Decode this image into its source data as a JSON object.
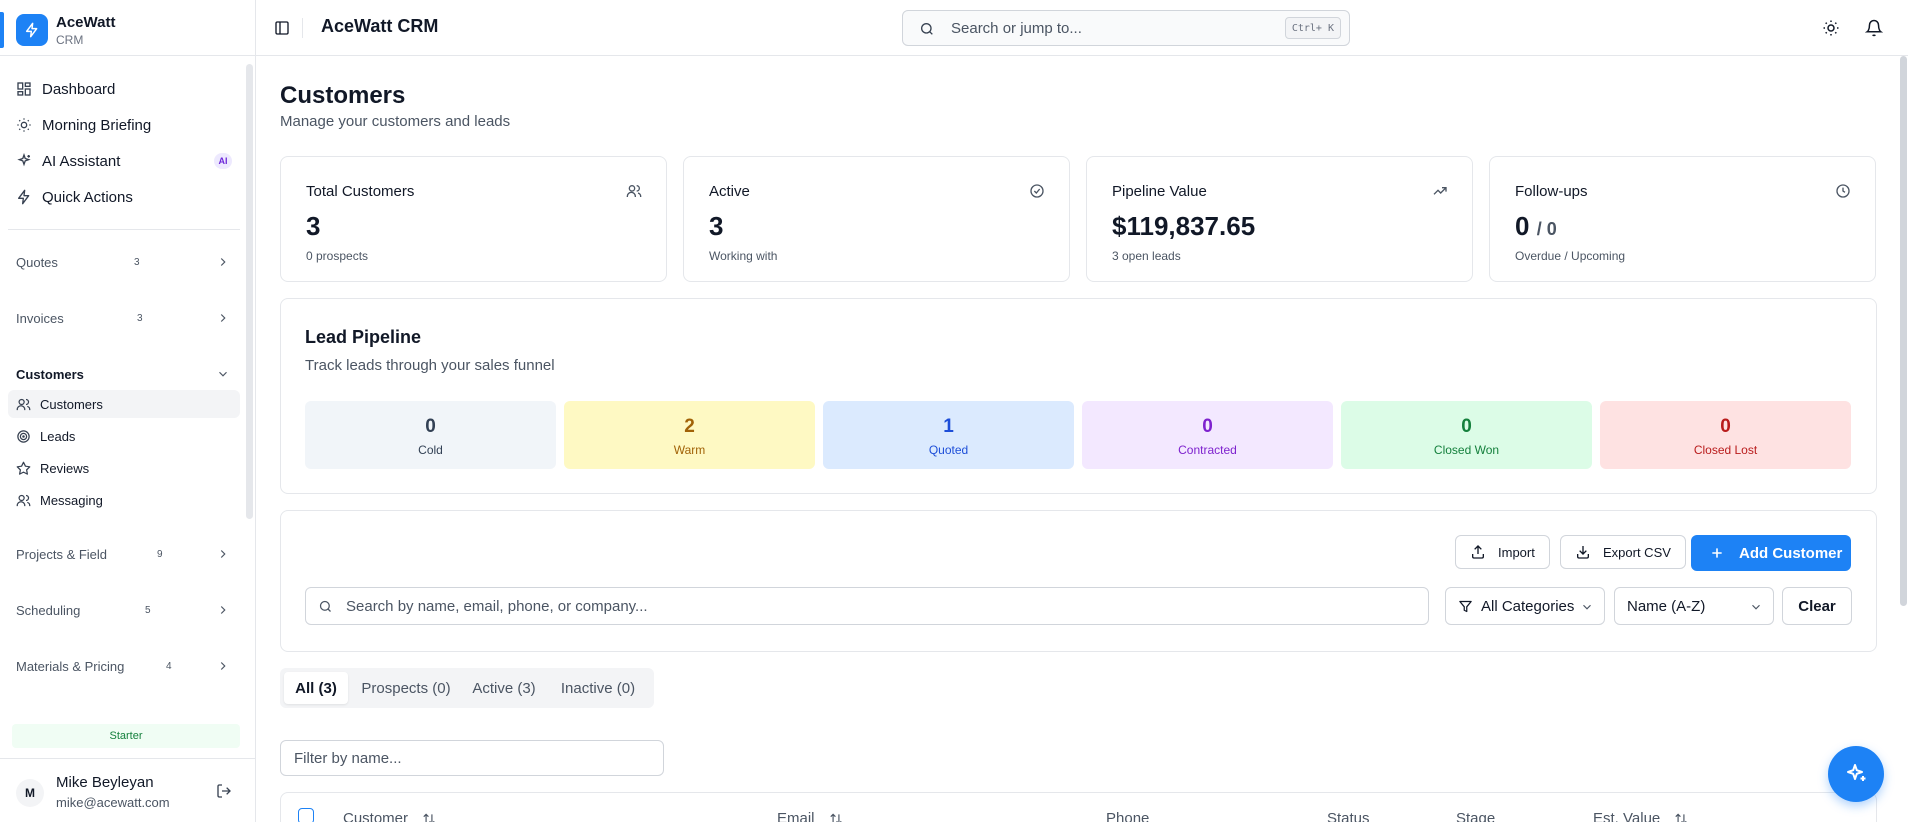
{
  "brand": {
    "name": "AceWatt",
    "sub": "CRM",
    "color": "#1d82f5"
  },
  "nav": [
    {
      "label": "Dashboard",
      "icon": "dashboard-icon"
    },
    {
      "label": "Morning Briefing",
      "icon": "sun-icon"
    },
    {
      "label": "AI Assistant",
      "icon": "sparkles-icon",
      "badge": "AI"
    },
    {
      "label": "Quick Actions",
      "icon": "lightning-icon"
    }
  ],
  "groups": {
    "quotes": {
      "label": "Quotes",
      "count": "3"
    },
    "invoices": {
      "label": "Invoices",
      "count": "3"
    },
    "customers": {
      "label": "Customers"
    },
    "projects": {
      "label": "Projects & Field",
      "count": "9"
    },
    "scheduling": {
      "label": "Scheduling",
      "count": "5"
    },
    "materials": {
      "label": "Materials & Pricing",
      "count": "4"
    }
  },
  "customer_items": [
    {
      "label": "Customers",
      "icon": "users-icon"
    },
    {
      "label": "Leads",
      "icon": "target-icon"
    },
    {
      "label": "Reviews",
      "icon": "star-icon"
    },
    {
      "label": "Messaging",
      "icon": "users-icon"
    }
  ],
  "plan": "Starter",
  "user": {
    "initial": "M",
    "name": "Mike Beyleyan",
    "email": "mike@acewatt.com"
  },
  "topbar": {
    "title": "AceWatt CRM",
    "search_placeholder": "Search or jump to...",
    "shortcut": "Ctrl+ K"
  },
  "page": {
    "title": "Customers",
    "subtitle": "Manage your customers and leads"
  },
  "stats": [
    {
      "label": "Total Customers",
      "value": "3",
      "note": "0 prospects",
      "icon": "users-icon"
    },
    {
      "label": "Active",
      "value": "3",
      "note": "Working with",
      "icon": "check-circle-icon"
    },
    {
      "label": "Pipeline Value",
      "value": "$119,837.65",
      "note": "3 open leads",
      "icon": "trending-up-icon"
    },
    {
      "label": "Follow-ups",
      "value": "0",
      "value_suffix": "/ 0",
      "note": "Overdue / Upcoming",
      "icon": "clock-icon"
    }
  ],
  "pipeline": {
    "title": "Lead Pipeline",
    "subtitle": "Track leads through your sales funnel",
    "stages": [
      {
        "count": "0",
        "label": "Cold",
        "bg": "#f1f5f9",
        "fg": "#334155"
      },
      {
        "count": "2",
        "label": "Warm",
        "bg": "#fef9c3",
        "fg": "#a16207"
      },
      {
        "count": "1",
        "label": "Quoted",
        "bg": "#dbeafe",
        "fg": "#1d4ed8"
      },
      {
        "count": "0",
        "label": "Contracted",
        "bg": "#f3e8ff",
        "fg": "#7e22ce"
      },
      {
        "count": "0",
        "label": "Closed Won",
        "bg": "#dcfce7",
        "fg": "#15803d"
      },
      {
        "count": "0",
        "label": "Closed Lost",
        "bg": "#fee2e2",
        "fg": "#b91c1c"
      }
    ]
  },
  "actions": {
    "import": "Import",
    "export": "Export CSV",
    "add": "Add Customer"
  },
  "filters": {
    "search_placeholder": "Search by name, email, phone, or company...",
    "category": "All Categories",
    "sort": "Name (A-Z)",
    "clear": "Clear"
  },
  "tabs": [
    "All (3)",
    "Prospects (0)",
    "Active (3)",
    "Inactive (0)"
  ],
  "name_filter_placeholder": "Filter by name...",
  "table": {
    "columns": [
      "Customer",
      "Email",
      "Phone",
      "Status",
      "Stage",
      "Est. Value"
    ]
  }
}
